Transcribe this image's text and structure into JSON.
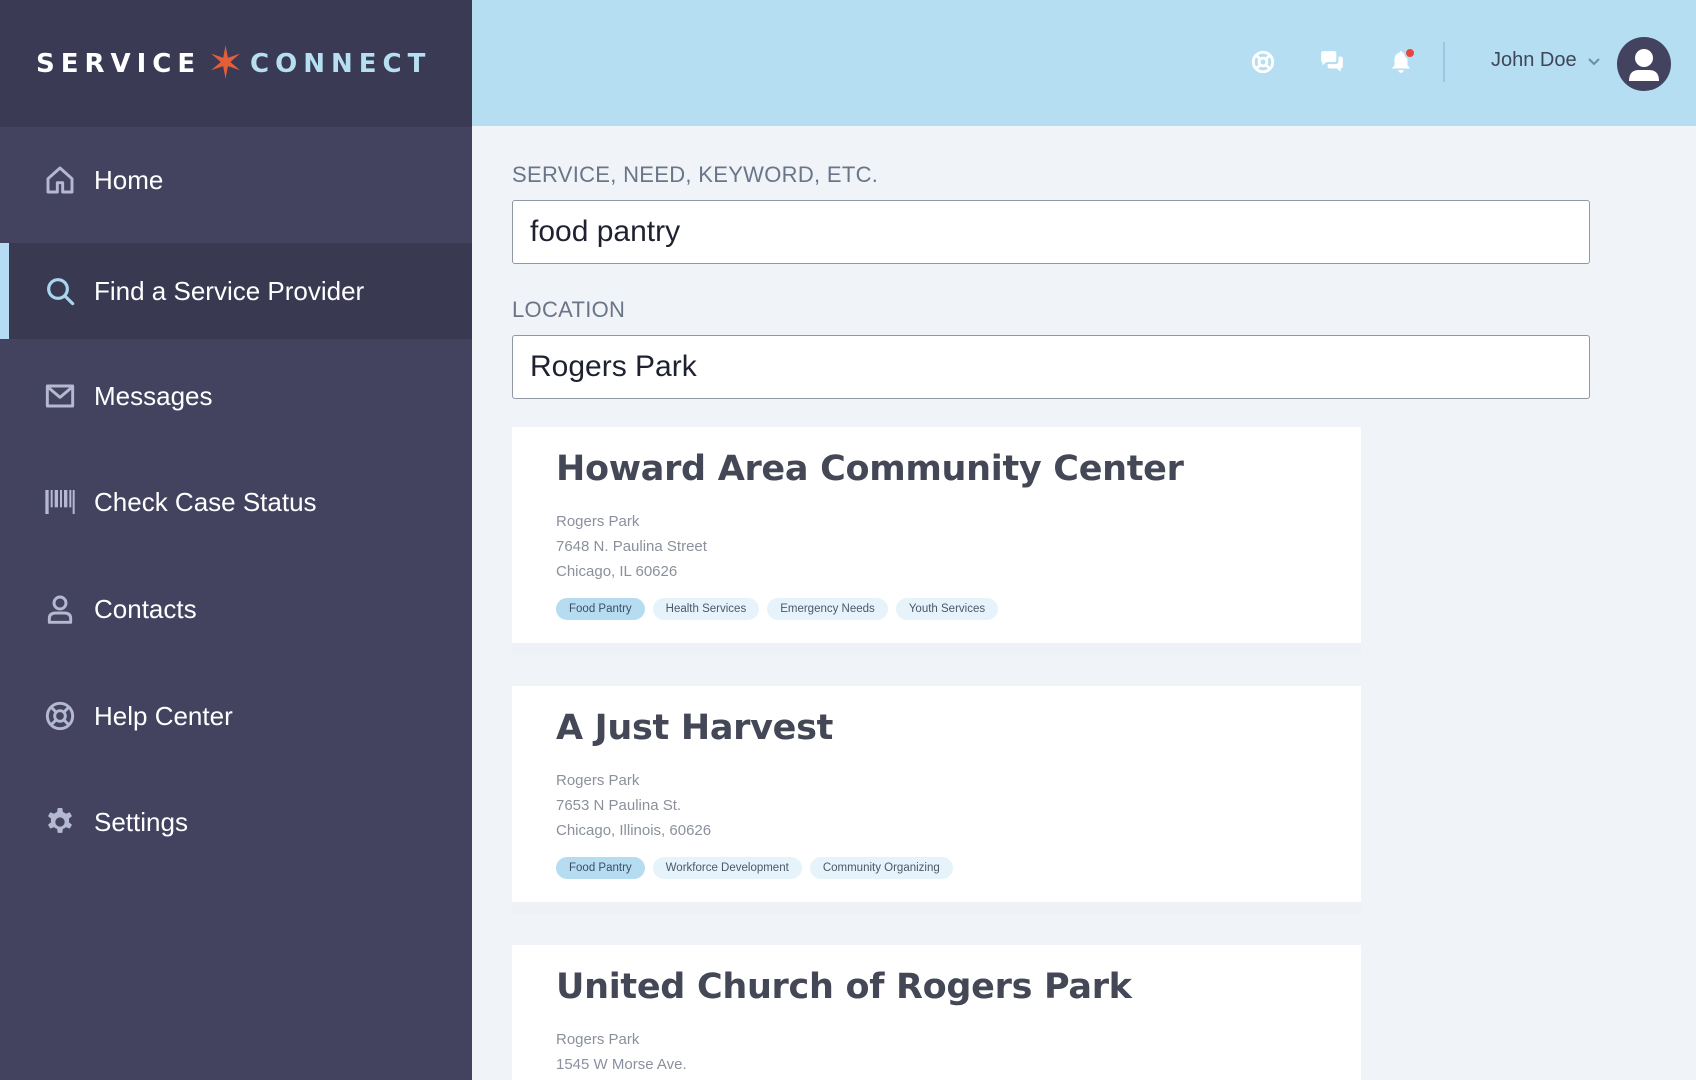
{
  "logo": {
    "left": "SERVICE",
    "star": "✶",
    "right": "CONNECT"
  },
  "nav": {
    "items": [
      {
        "label": "Home",
        "icon": "home-icon",
        "active": false
      },
      {
        "label": "Find a Service Provider",
        "icon": "search-icon",
        "active": true
      },
      {
        "label": "Messages",
        "icon": "envelope-icon",
        "active": false
      },
      {
        "label": "Check Case Status",
        "icon": "barcode-icon",
        "active": false
      },
      {
        "label": "Contacts",
        "icon": "user-icon",
        "active": false
      },
      {
        "label": "Help Center",
        "icon": "lifebuoy-icon",
        "active": false
      },
      {
        "label": "Settings",
        "icon": "gear-icon",
        "active": false
      }
    ]
  },
  "topbar": {
    "icons": [
      "lifebuoy-icon",
      "chat-icon",
      "bell-icon"
    ],
    "notification_dot": true,
    "user_name": "John Doe"
  },
  "search": {
    "keyword_label": "SERVICE, NEED, KEYWORD, ETC.",
    "keyword_value": "food pantry",
    "location_label": "LOCATION",
    "location_value": "Rogers Park"
  },
  "results": [
    {
      "name": "Howard Area Community Center",
      "address": [
        "Rogers Park",
        "7648 N. Paulina Street",
        "Chicago, IL 60626"
      ],
      "tags": [
        "Food Pantry",
        "Health Services",
        "Emergency Needs",
        "Youth Services"
      ]
    },
    {
      "name": "A Just Harvest",
      "address": [
        "Rogers Park",
        "7653 N Paulina St.",
        "Chicago, Illinois, 60626"
      ],
      "tags": [
        "Food Pantry",
        "Workforce Development",
        "Community Organizing"
      ]
    },
    {
      "name": "United Church of Rogers Park",
      "address": [
        "Rogers Park",
        "1545 W Morse Ave."
      ],
      "tags": []
    }
  ],
  "colors": {
    "sidebar": "#434360",
    "sidebar_dark": "#3a3a54",
    "topbar": "#b5def2",
    "accent_star": "#e45e3a",
    "notification": "#e8453c"
  }
}
